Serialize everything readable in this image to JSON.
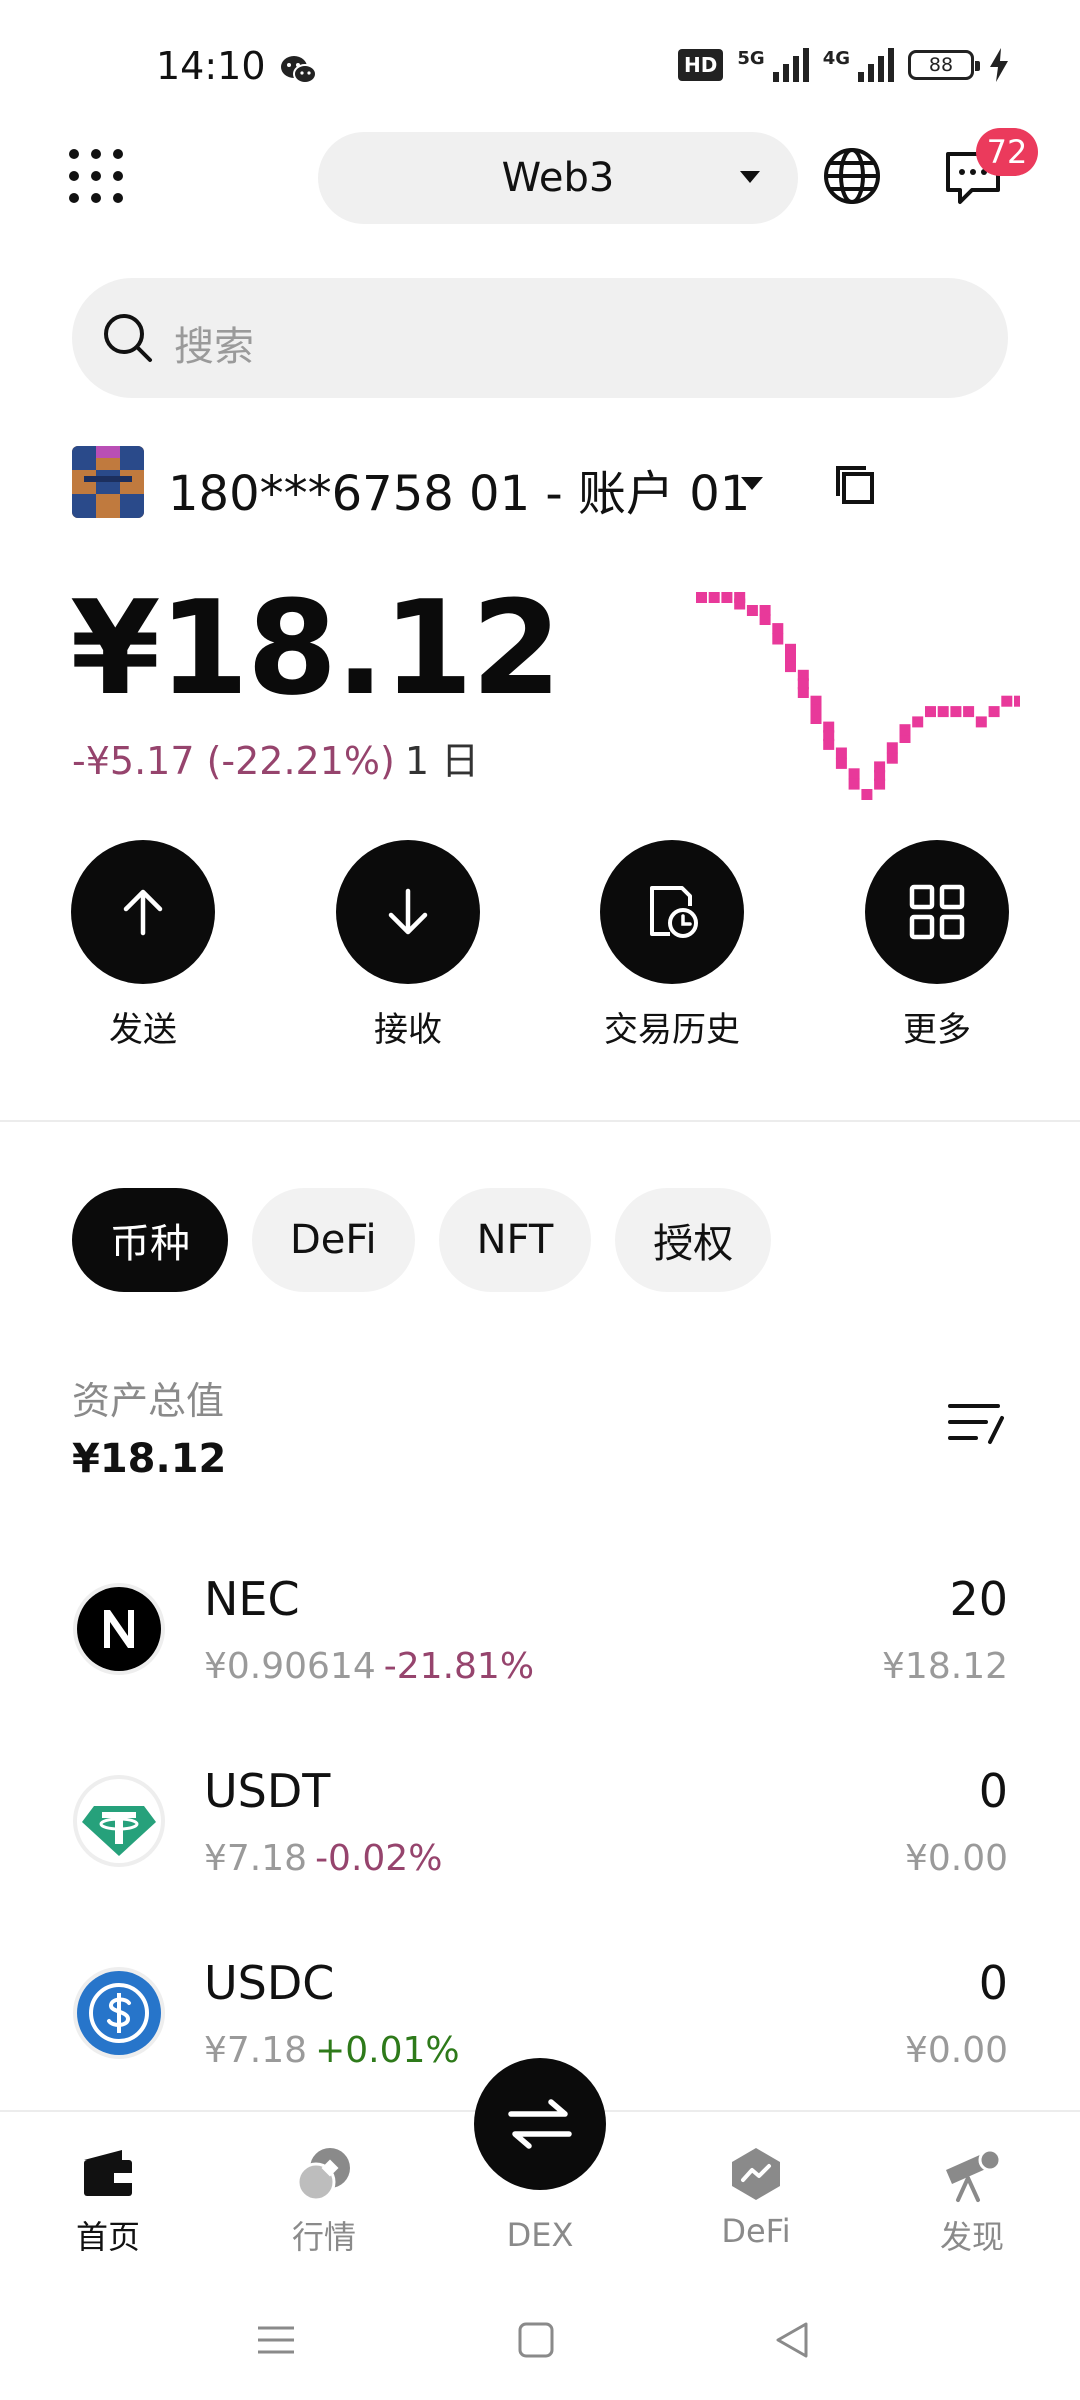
{
  "status_bar": {
    "time": "14:10",
    "network_1": "5G",
    "network_2": "4G",
    "hd_label": "HD",
    "battery": "88"
  },
  "top_bar": {
    "network_label": "Web3",
    "notification_count": "72"
  },
  "search": {
    "placeholder": "搜索"
  },
  "account": {
    "name": "180***6758 01 - 账户 01"
  },
  "balance": {
    "total": "¥18.12",
    "change": "-¥5.17 (-22.21%)",
    "period": "1 日"
  },
  "chart_data": {
    "type": "line",
    "color": "#e8399a",
    "series": [
      {
        "values": [
          1.0,
          1.0,
          1.0,
          1.0,
          0.95,
          0.95,
          0.88,
          0.8,
          0.7,
          0.6,
          0.5,
          0.4,
          0.32,
          0.24,
          0.28,
          0.38,
          0.46,
          0.52,
          0.56,
          0.56,
          0.56,
          0.56,
          0.52,
          0.56,
          0.6,
          0.6
        ]
      }
    ]
  },
  "actions": [
    {
      "label": "发送",
      "icon": "arrow-up-icon"
    },
    {
      "label": "接收",
      "icon": "arrow-down-icon"
    },
    {
      "label": "交易历史",
      "icon": "history-icon"
    },
    {
      "label": "更多",
      "icon": "grid-icon"
    }
  ],
  "tabs": [
    "币种",
    "DeFi",
    "NFT",
    "授权"
  ],
  "assets_summary": {
    "label": "资产总值",
    "value": "¥18.12"
  },
  "assets": [
    {
      "symbol": "NEC",
      "price": "¥0.90614",
      "change": "-21.81%",
      "direction": "down",
      "amount": "20",
      "value": "¥18.12",
      "icon_color": "#000000"
    },
    {
      "symbol": "USDT",
      "price": "¥7.18",
      "change": "-0.02%",
      "direction": "down",
      "amount": "0",
      "value": "¥0.00",
      "icon_color": "#26a17b"
    },
    {
      "symbol": "USDC",
      "price": "¥7.18",
      "change": "+0.01%",
      "direction": "up",
      "amount": "0",
      "value": "¥0.00",
      "icon_color": "#2775ca"
    }
  ],
  "bottom_nav": [
    {
      "label": "首页",
      "icon": "wallet-icon",
      "active": true
    },
    {
      "label": "行情",
      "icon": "market-icon",
      "active": false
    },
    {
      "label": "DEX",
      "icon": "swap-icon",
      "active": false
    },
    {
      "label": "DeFi",
      "icon": "defi-icon",
      "active": false
    },
    {
      "label": "发现",
      "icon": "telescope-icon",
      "active": false
    }
  ],
  "colors": {
    "negative": "#96446d",
    "positive": "#2e7a1a",
    "badge": "#eb3a5c"
  }
}
